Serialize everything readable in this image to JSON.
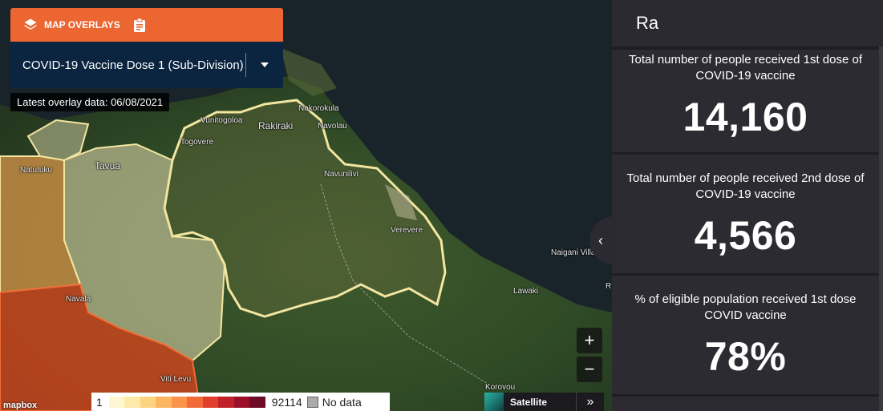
{
  "overlay": {
    "header_label": "MAP OVERLAYS",
    "selected": "COVID-19 Vaccine Dose 1 (Sub-Division)",
    "latest_data": "Latest overlay data: 06/08/2021"
  },
  "map": {
    "places": [
      "Nakorokula",
      "Vunitogoloa",
      "Rakiraki",
      "Navolau",
      "Togovere",
      "Tavua",
      "Natutuku",
      "Navunilivi",
      "Verevere",
      "Naigani Village",
      "Lawaki",
      "Navala",
      "Viti Levu",
      "Korovou",
      "R"
    ],
    "zoom_in": "+",
    "zoom_out": "−",
    "attribution": "mapbox"
  },
  "legend": {
    "min": "1",
    "max": "92114",
    "no_data": "No data",
    "colors": [
      "#fff7d4",
      "#fde9a8",
      "#fdd482",
      "#fcb65f",
      "#f9944a",
      "#f26a38",
      "#e03e2f",
      "#c1222a",
      "#9b0f29",
      "#6f0b26"
    ]
  },
  "basemap": {
    "label": "Satellite"
  },
  "panel": {
    "title": "Ra",
    "stats": [
      {
        "label": "Total number of people received 1st dose of COVID-19 vaccine",
        "value": "14,160"
      },
      {
        "label": "Total number of people received 2nd dose of COVID-19 vaccine",
        "value": "4,566"
      },
      {
        "label": "% of eligible population received 1st dose COVID vaccine",
        "value": "78%"
      }
    ]
  }
}
